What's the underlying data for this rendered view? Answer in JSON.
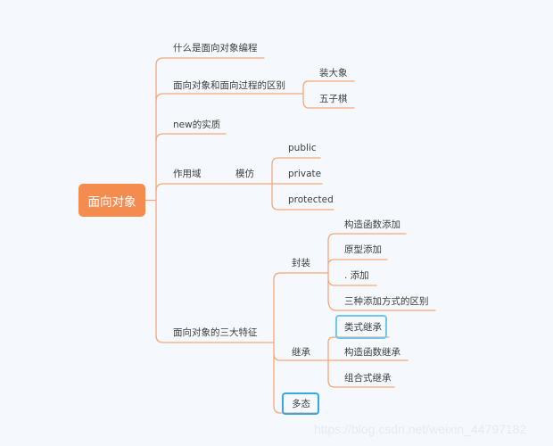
{
  "colors": {
    "background": "#f5f9fd",
    "root_fill": "#f58c4f",
    "connector": "#f5a77a",
    "selection_light": "#6fc7f0",
    "selection_strong": "#34a9e4"
  },
  "root": {
    "label": "面向对象"
  },
  "branches": [
    {
      "label": "什么是面向对象编程"
    },
    {
      "label": "面向对象和面向过程的区别",
      "children": [
        {
          "label": "装大象"
        },
        {
          "label": "五子棋"
        }
      ]
    },
    {
      "label": "new的实质"
    },
    {
      "label": "作用域",
      "children": [
        {
          "label": "模仿",
          "children": [
            {
              "label": "public"
            },
            {
              "label": "private"
            },
            {
              "label": "protected"
            }
          ]
        }
      ]
    },
    {
      "label": "面向对象的三大特征",
      "children": [
        {
          "label": "封装",
          "children": [
            {
              "label": "构造函数添加"
            },
            {
              "label": "原型添加"
            },
            {
              "label": ". 添加"
            },
            {
              "label": "三种添加方式的区别"
            }
          ]
        },
        {
          "label": "继承",
          "children": [
            {
              "label": "类式继承",
              "selected": true
            },
            {
              "label": "构造函数继承"
            },
            {
              "label": "组合式继承"
            }
          ]
        },
        {
          "label": "多态",
          "selected": true
        }
      ]
    }
  ],
  "watermark": "https://blog.csdn.net/weixin_44797182"
}
